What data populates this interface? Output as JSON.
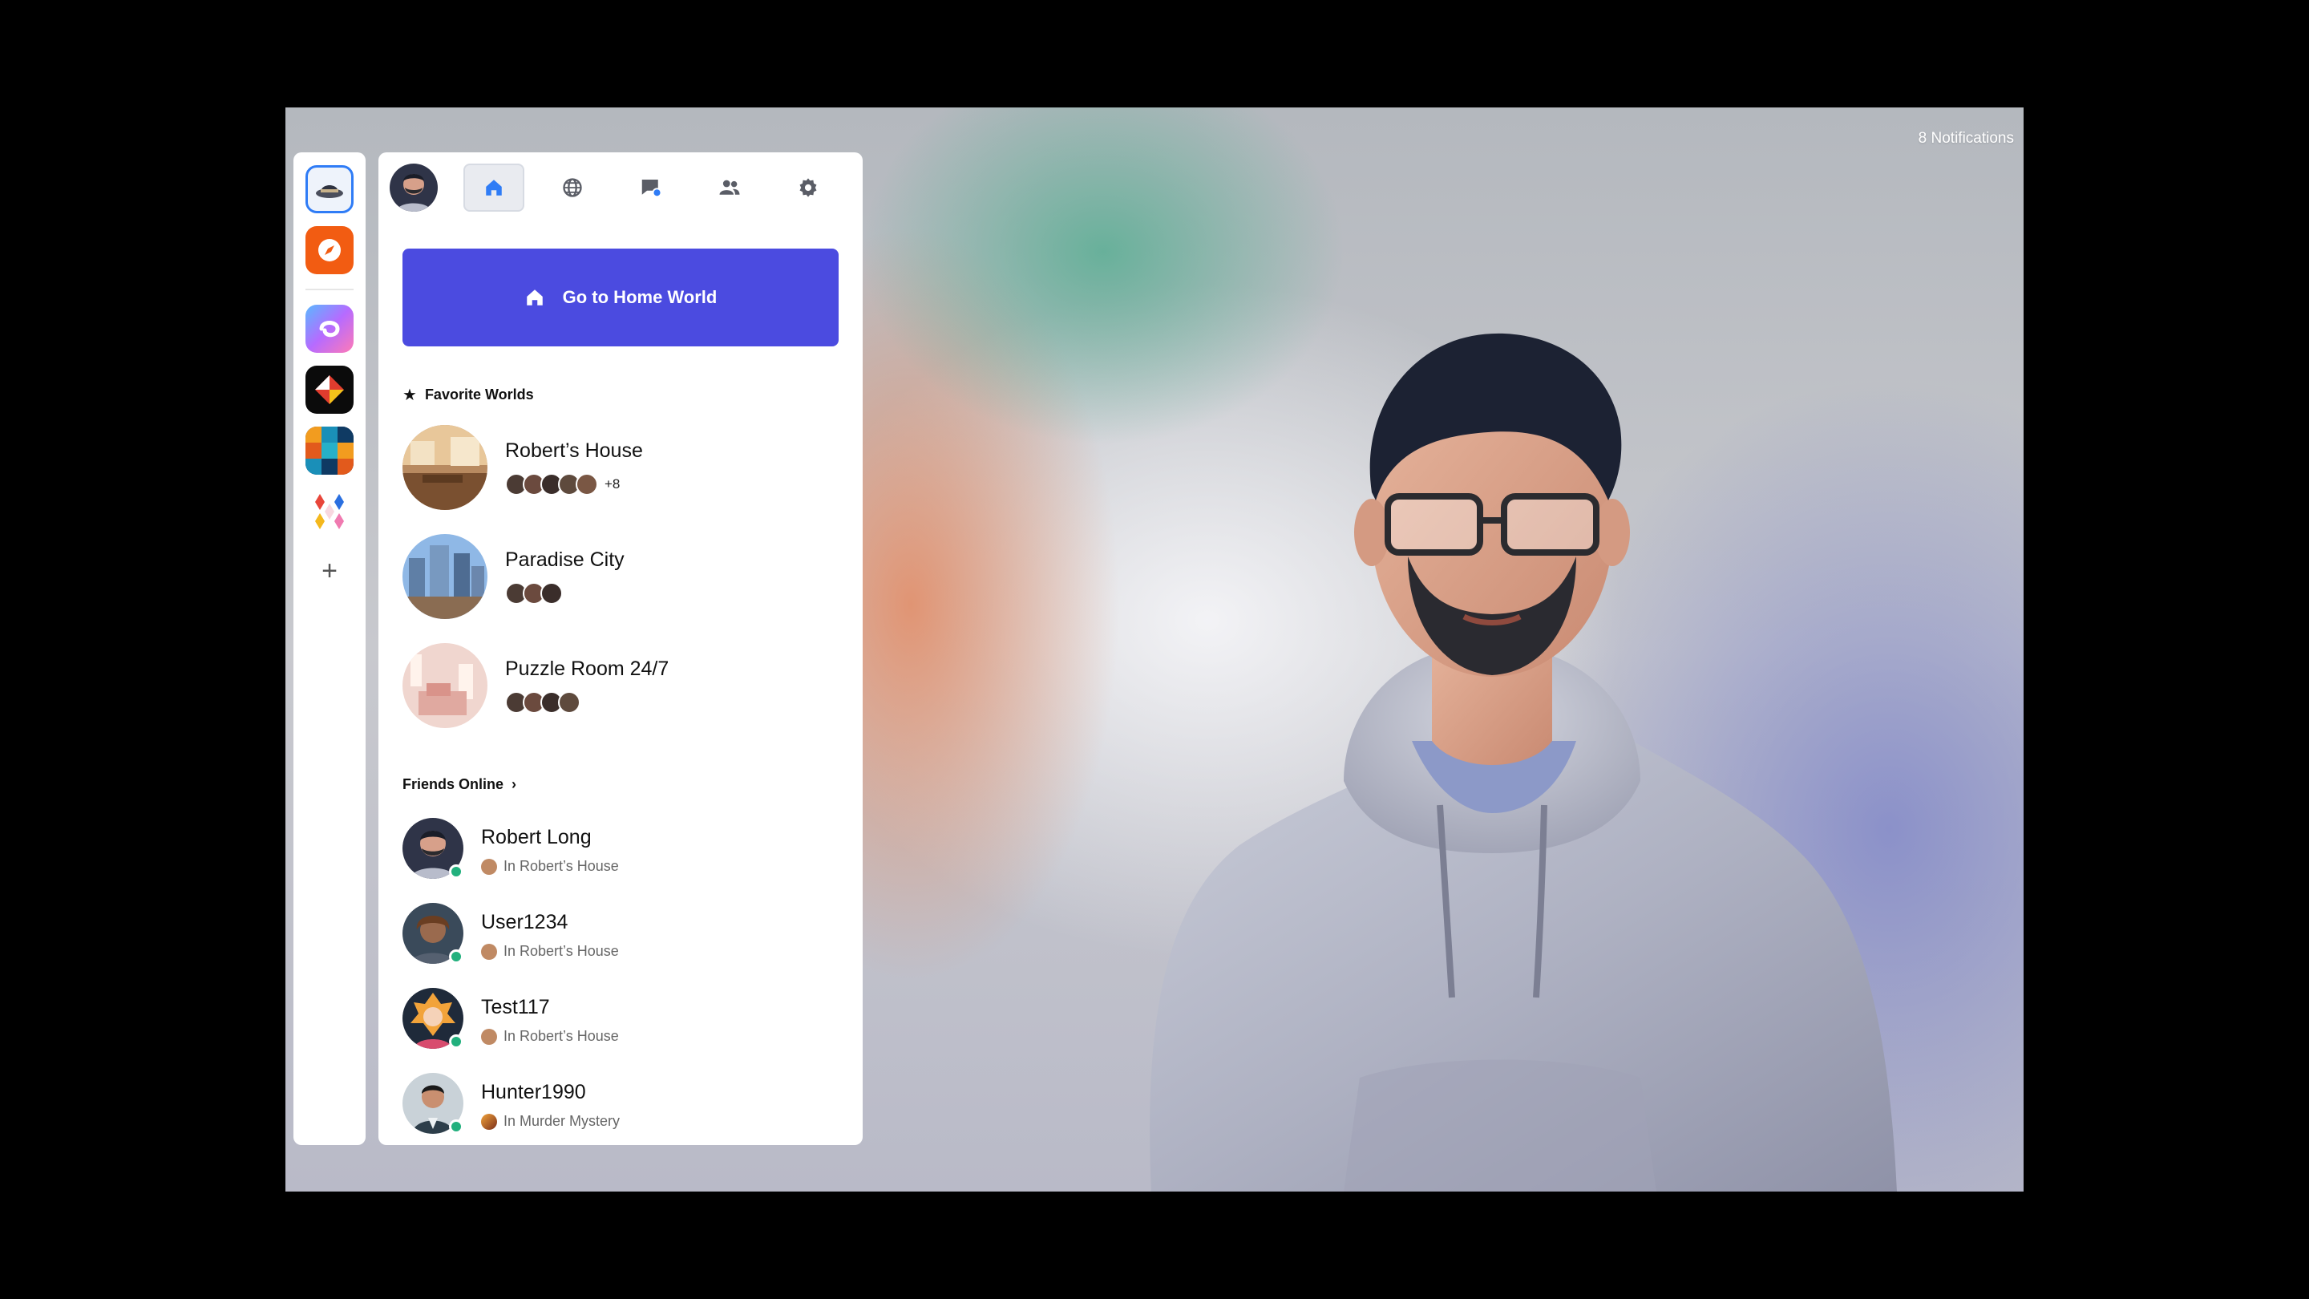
{
  "notifications": {
    "label": "8 Notifications"
  },
  "rail": {
    "apps": [
      {
        "name": "hat-app",
        "selected": true
      },
      {
        "name": "compass-app"
      },
      {
        "name": "swirl-app"
      },
      {
        "name": "shape-app"
      },
      {
        "name": "blocks-app"
      },
      {
        "name": "star-app"
      }
    ],
    "add_label": "+"
  },
  "nav": {
    "tabs": [
      "home-icon",
      "globe-icon",
      "chat-icon",
      "friends-icon",
      "settings-icon"
    ],
    "active_tab": "home-icon",
    "chat_badge_color": "#2f7cf6"
  },
  "home_button": {
    "label": "Go to Home World",
    "icon": "home-icon",
    "color": "#4b4be0"
  },
  "favorites": {
    "title": "Favorite Worlds",
    "icon": "star-icon",
    "worlds": [
      {
        "name": "Robert’s House",
        "visitor_faces": 5,
        "more": "+8"
      },
      {
        "name": "Paradise City",
        "visitor_faces": 3,
        "more": ""
      },
      {
        "name": "Puzzle Room 24/7",
        "visitor_faces": 4,
        "more": ""
      }
    ]
  },
  "friends": {
    "title": "Friends Online",
    "items": [
      {
        "name": "Robert Long",
        "location": "In Robert’s House",
        "status": "online"
      },
      {
        "name": "User1234",
        "location": "In Robert’s House",
        "status": "online"
      },
      {
        "name": "Test117",
        "location": "In Robert’s House",
        "status": "online"
      },
      {
        "name": "Hunter1990",
        "location": "In Murder Mystery",
        "status": "online"
      }
    ]
  },
  "colors": {
    "accent": "#4b4be0",
    "online": "#22b07d",
    "selected_border": "#2f7cf6"
  }
}
